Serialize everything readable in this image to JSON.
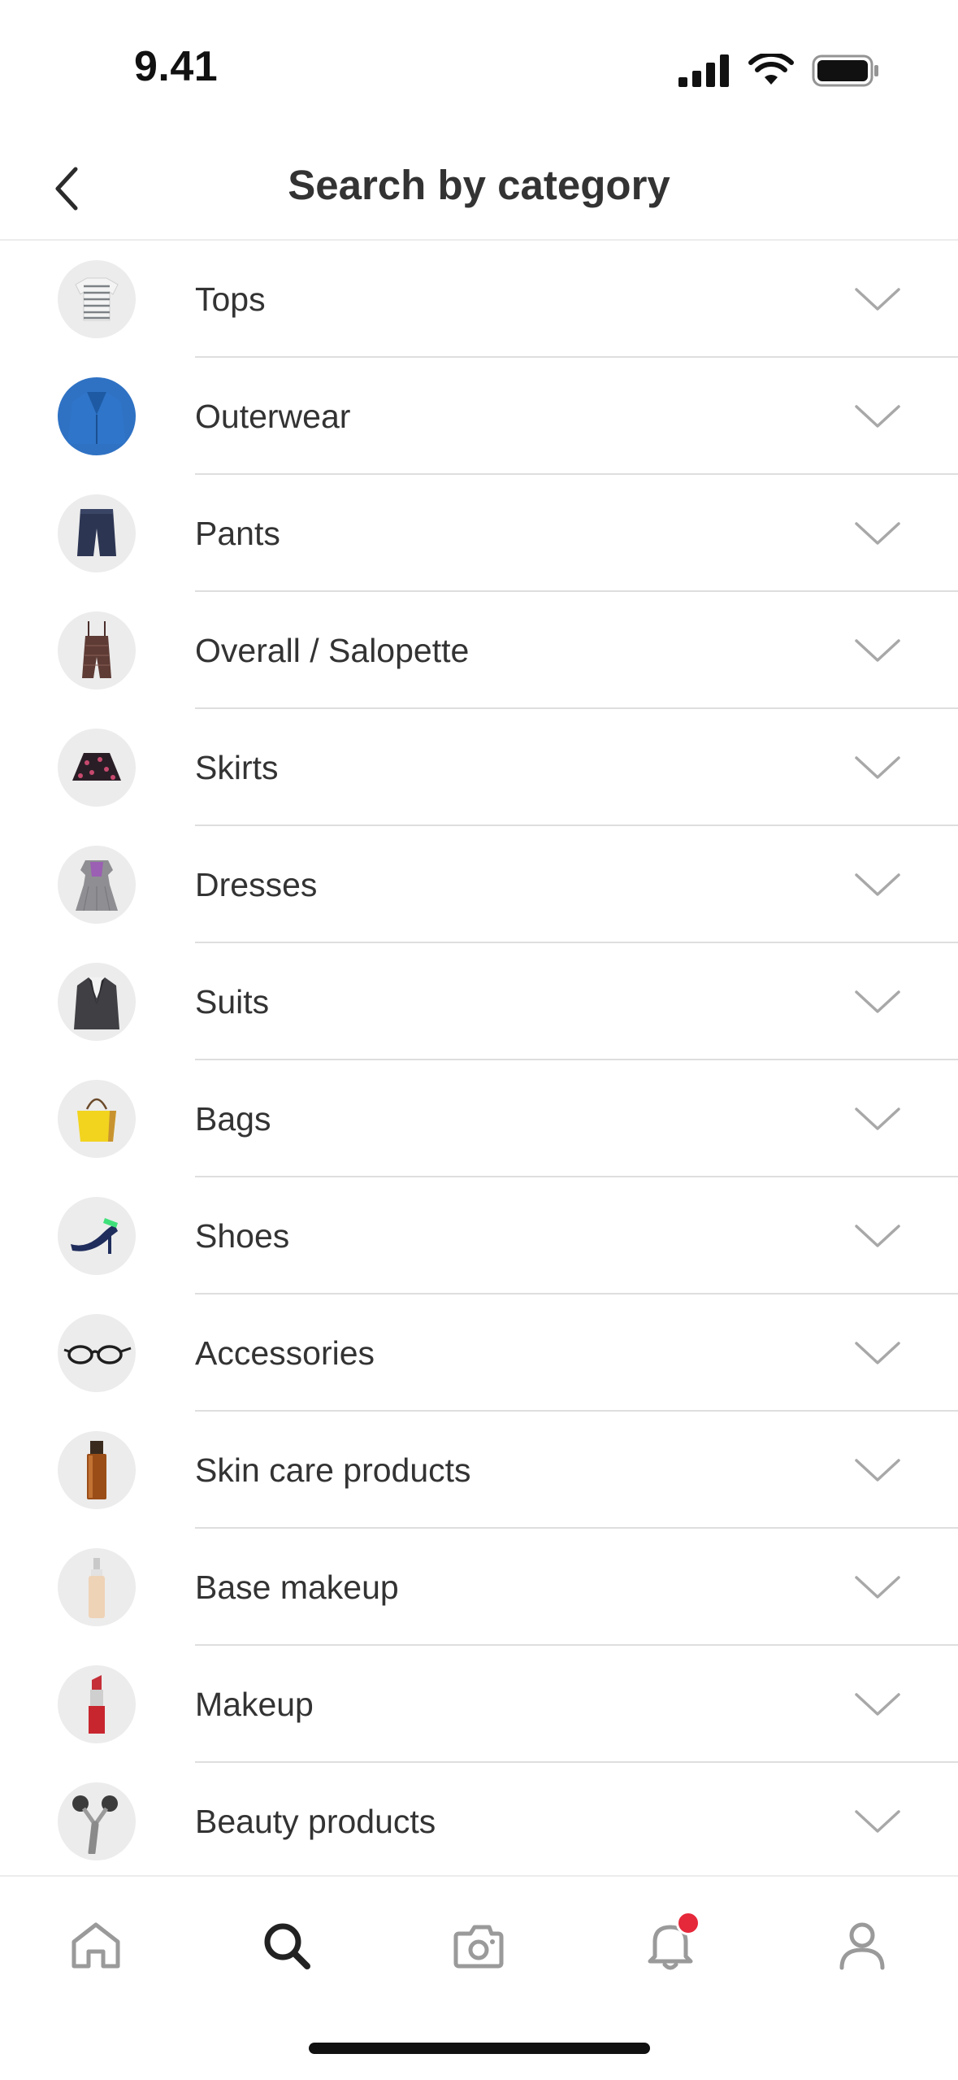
{
  "status_bar": {
    "time": "9.41"
  },
  "header": {
    "title": "Search by category"
  },
  "categories": [
    {
      "label": "Tops",
      "icon": "striped-tshirt-thumbnail"
    },
    {
      "label": "Outerwear",
      "icon": "blue-jacket-thumbnail"
    },
    {
      "label": "Pants",
      "icon": "denim-pants-thumbnail"
    },
    {
      "label": "Overall / Salopette",
      "icon": "overall-thumbnail"
    },
    {
      "label": "Skirts",
      "icon": "floral-skirt-thumbnail"
    },
    {
      "label": "Dresses",
      "icon": "grey-dress-thumbnail"
    },
    {
      "label": "Suits",
      "icon": "suit-jacket-thumbnail"
    },
    {
      "label": "Bags",
      "icon": "yellow-tote-thumbnail"
    },
    {
      "label": "Shoes",
      "icon": "high-heel-thumbnail"
    },
    {
      "label": "Accessories",
      "icon": "glasses-thumbnail"
    },
    {
      "label": "Skin care products",
      "icon": "amber-bottle-thumbnail"
    },
    {
      "label": "Base makeup",
      "icon": "foundation-bottle-thumbnail"
    },
    {
      "label": "Makeup",
      "icon": "lipstick-thumbnail"
    },
    {
      "label": "Beauty products",
      "icon": "facial-roller-thumbnail"
    }
  ],
  "tab_bar": {
    "tabs": [
      {
        "name": "home",
        "icon": "home-icon",
        "active": false
      },
      {
        "name": "search",
        "icon": "search-icon",
        "active": true
      },
      {
        "name": "camera",
        "icon": "camera-icon",
        "active": false
      },
      {
        "name": "notifications",
        "icon": "bell-icon",
        "active": false,
        "badge": true
      },
      {
        "name": "profile",
        "icon": "person-icon",
        "active": false
      }
    ]
  },
  "colors": {
    "text": "#333333",
    "divider": "#dedede",
    "chevron": "#a8a8a8",
    "inactive_tab": "#9a9a9a",
    "active_tab": "#222222",
    "badge": "#e5283a"
  }
}
